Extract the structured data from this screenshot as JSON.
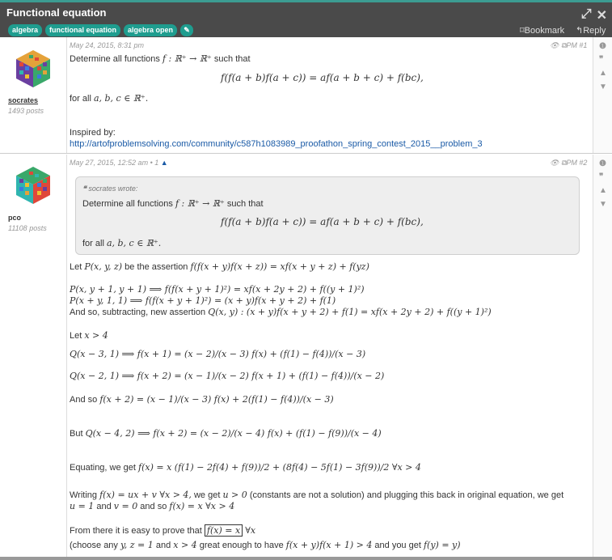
{
  "header": {
    "title": "Functional equation",
    "tags": [
      "algebra",
      "functional equation",
      "algebra open"
    ],
    "bookmark_label": "Bookmark",
    "reply_label": "Reply"
  },
  "posts": [
    {
      "date": "May 24, 2015, 8:31 pm",
      "pm": "PM #1",
      "username": "socrates",
      "post_count": "1493 posts",
      "text1": "Determine all functions",
      "math1": "f : ℝ⁺ → ℝ⁺",
      "text1b": "such that",
      "display": "f(f(a + b)f(a + c)) = af(a + b + c) + f(bc),",
      "text2": "for all",
      "math2": "a, b, c ∈ ℝ⁺.",
      "inspired": "Inspired by:",
      "link": "http://artofproblemsolving.com/community/c587h1083989_proofathon_spring_contest_2015__problem_3"
    },
    {
      "date": "May 27, 2015, 12:52 am",
      "date_suffix": "• 1",
      "pm": "PM #2",
      "username": "pco",
      "post_count": "11108 posts",
      "quote_author": "socrates wrote:",
      "quote_text1": "Determine all functions",
      "quote_math1": "f : ℝ⁺ → ℝ⁺",
      "quote_text1b": "such that",
      "quote_display": "f(f(a + b)f(a + c)) = af(a + b + c) + f(bc),",
      "quote_text2": "for all",
      "quote_math2": "a, b, c ∈ ℝ⁺.",
      "l1a": "Let",
      "l1m": "P(x, y, z)",
      "l1b": "be the assertion",
      "l1m2": "f(f(x + y)f(x + z)) = xf(x + y + z) + f(yz)",
      "l2": "P(x, y + 1, y + 1) ⟹ f(f(x + y + 1)²) = xf(x + 2y + 2) + f((y + 1)²)",
      "l3": "P(x + y, 1, 1) ⟹ f(f(x + y + 1)²) = (x + y)f(x + y + 2) + f(1)",
      "l4a": "And so, subtracting, new assertion",
      "l4m": "Q(x, y) : (x + y)f(x + y + 2) + f(1) = xf(x + 2y + 2) + f((y + 1)²)",
      "l5a": "Let",
      "l5m": "x > 4",
      "l6": "Q(x − 3, 1) ⟹ f(x + 1) = (x − 2)/(x − 3) f(x) + (f(1) − f(4))/(x − 3)",
      "l7": "Q(x − 2, 1) ⟹ f(x + 2) = (x − 1)/(x − 2) f(x + 1) + (f(1) − f(4))/(x − 2)",
      "l8a": "And so",
      "l8m": "f(x + 2) = (x − 1)/(x − 3) f(x) + 2(f(1) − f(4))/(x − 3)",
      "l9a": "But",
      "l9m": "Q(x − 4, 2) ⟹ f(x + 2) = (x − 2)/(x − 4) f(x) + (f(1) − f(9))/(x − 4)",
      "l10a": "Equating, we get",
      "l10m": "f(x) = x (f(1) − 2f(4) + f(9))/2 + (8f(4) − 5f(1) − 3f(9))/2 ∀x > 4",
      "l11a": "Writing",
      "l11m1": "f(x) = ux + v ∀x > 4,",
      "l11b": "we get",
      "l11m2": "u > 0",
      "l11c": "(constants are not a solution) and plugging this back in original equation, we get",
      "l12m1": "u = 1",
      "l12a": "and",
      "l12m2": "v = 0",
      "l12b": "and so",
      "l12m3": "f(x) = x ∀x > 4",
      "l13a": "From there it is easy to prove that",
      "l13m": "f(x) = x",
      "l13m2": "∀x",
      "l14a": "(choose any",
      "l14m1": "y, z = 1",
      "l14b": "and",
      "l14m2": "x > 4",
      "l14c": "great enough to have",
      "l14m3": "f(x + y)f(x + 1) > 4",
      "l14d": "and you get",
      "l14m4": "f(y) = y)"
    }
  ],
  "colors": {
    "topbar": "#4a4a4a",
    "tag": "#1f9d8f",
    "link": "#1a5aa6",
    "accent": "#3c9c92"
  },
  "icons": [
    "expand-icon",
    "close-icon",
    "pencil-icon",
    "bookmark-icon",
    "reply-icon",
    "eye-icon",
    "pm-icon",
    "info-icon",
    "quote-icon",
    "thumbs-up-icon",
    "thumbs-down-icon"
  ]
}
